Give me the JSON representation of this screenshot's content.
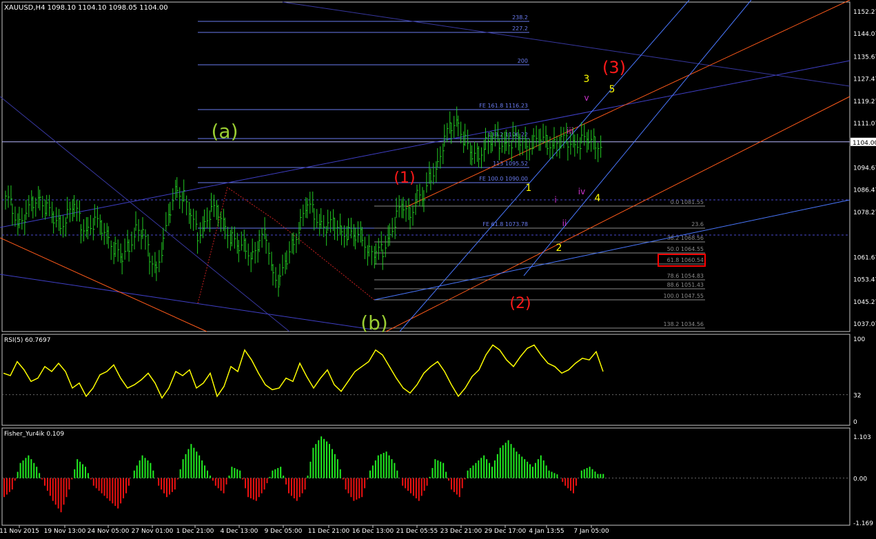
{
  "main": {
    "symbol_header": "XAUUSD,H4 1098.10 1104.10 1098.05 1104.00",
    "price_axis": [
      "1152.27",
      "1144.07",
      "1135.67",
      "1127.47",
      "1119.27",
      "1111.07",
      "1104.00",
      "1094.67",
      "1086.47",
      "1078.27",
      "1061.67",
      "1053.47",
      "1045.27",
      "1037.07"
    ],
    "current_price_label": "1104.00",
    "fib_levels": [
      {
        "label": "238.2",
        "color": "#6a7cf0"
      },
      {
        "label": "227.2",
        "color": "#6a7cf0"
      },
      {
        "label": "200",
        "color": "#6a7cf0"
      },
      {
        "label": "FE 161.8 1116.23",
        "color": "#6a7cf0"
      },
      {
        "label": "138.2 1106.22",
        "color": "#6a7cf0"
      },
      {
        "label": "113 1095.52",
        "color": "#6a7cf0"
      },
      {
        "label": "FE 100.0 1090.00",
        "color": "#6a7cf0"
      },
      {
        "label": "0.0 1081.55",
        "color": "#8a8a8a"
      },
      {
        "label": "FE 61.8 1073.78",
        "color": "#6a7cf0"
      },
      {
        "label": "23.6",
        "color": "#8a8a8a"
      },
      {
        "label": "38.2 1068.56",
        "color": "#8a8a8a"
      },
      {
        "label": "50.0 1064.55",
        "color": "#8a8a8a"
      },
      {
        "label": "61.8 1060.54",
        "color": "#8a8a8a"
      },
      {
        "label": "78.6 1054.83",
        "color": "#8a8a8a"
      },
      {
        "label": "88.6 1051.43",
        "color": "#8a8a8a"
      },
      {
        "label": "100.0 1047.55",
        "color": "#8a8a8a"
      },
      {
        "label": "138.2 1034.56",
        "color": "#8a8a8a"
      }
    ],
    "wave_labels": [
      {
        "text": "(a)",
        "color": "#9acd32"
      },
      {
        "text": "(b)",
        "color": "#9acd32"
      },
      {
        "text": "(1)",
        "color": "#ff1a1a"
      },
      {
        "text": "(2)",
        "color": "#ff1a1a"
      },
      {
        "text": "(3)",
        "color": "#ff1a1a"
      },
      {
        "text": "1",
        "color": "#ffff00"
      },
      {
        "text": "2",
        "color": "#ffff00"
      },
      {
        "text": "3",
        "color": "#ffff00"
      },
      {
        "text": "4",
        "color": "#ffff00"
      },
      {
        "text": "5",
        "color": "#ffff00"
      },
      {
        "text": "i",
        "color": "#cc33cc"
      },
      {
        "text": "ii",
        "color": "#cc33cc"
      },
      {
        "text": "iii",
        "color": "#cc33cc"
      },
      {
        "text": "iv",
        "color": "#cc33cc"
      },
      {
        "text": "v",
        "color": "#cc33cc"
      }
    ]
  },
  "rsi": {
    "header": "RSI(5) 60.7697",
    "axis": [
      "100",
      "32",
      "0"
    ],
    "color": "#ffff00"
  },
  "fisher": {
    "header": "Fisher_Yur4ik 0.109",
    "axis": [
      "1.103",
      "0.00",
      "-1.169"
    ],
    "pos_color": "#22ee22",
    "neg_color": "#ee1111"
  },
  "time_axis": [
    "11 Nov 2015",
    "19 Nov 13:00",
    "24 Nov 05:00",
    "27 Nov 01:00",
    "1 Dec 21:00",
    "4 Dec 13:00",
    "9 Dec 05:00",
    "11 Dec 21:00",
    "16 Dec 13:00",
    "21 Dec 05:55",
    "23 Dec 21:00",
    "29 Dec 17:00",
    "4 Jan 13:55",
    "7 Jan 05:00"
  ],
  "chart_data": {
    "type": "line",
    "title": "XAUUSD,H4",
    "ohlc_last": {
      "open": 1098.1,
      "high": 1104.1,
      "low": 1098.05,
      "close": 1104.0
    },
    "price_series": {
      "x_index": [
        0,
        10,
        20,
        30,
        40,
        50,
        60,
        70,
        80,
        90,
        100,
        110,
        120,
        130,
        140,
        150,
        160,
        170,
        180,
        190,
        200,
        210,
        220,
        230,
        240,
        250,
        260,
        270,
        280,
        290,
        300,
        310,
        320,
        330,
        340,
        350,
        360,
        370,
        380,
        390,
        400,
        410,
        420,
        430,
        440,
        450,
        460,
        470,
        480,
        490,
        500,
        510,
        520,
        530,
        540,
        550,
        560,
        570,
        580,
        590,
        600,
        610,
        620,
        630,
        640,
        650,
        660,
        670,
        680,
        690,
        700,
        710,
        720,
        730,
        740,
        750,
        760,
        770,
        780,
        790,
        800,
        810,
        820,
        830,
        840,
        850,
        860,
        870
      ],
      "close": [
        1084,
        1080,
        1074,
        1076,
        1082,
        1084,
        1079,
        1075,
        1074,
        1077,
        1080,
        1074,
        1072,
        1074,
        1072,
        1070,
        1064,
        1060,
        1066,
        1072,
        1070,
        1062,
        1058,
        1066,
        1078,
        1088,
        1084,
        1076,
        1070,
        1074,
        1078,
        1078,
        1074,
        1068,
        1064,
        1066,
        1062,
        1066,
        1070,
        1056,
        1052,
        1060,
        1068,
        1074,
        1080,
        1078,
        1074,
        1072,
        1074,
        1072,
        1070,
        1068,
        1070,
        1064,
        1062,
        1064,
        1070,
        1076,
        1080,
        1078,
        1084,
        1082,
        1092,
        1096,
        1104,
        1110,
        1112,
        1104,
        1098,
        1100,
        1104,
        1104,
        1104,
        1104,
        1104,
        1104,
        1104,
        1104,
        1104,
        1104,
        1104,
        1104,
        1104,
        1104,
        1104,
        1104,
        1104,
        1104
      ]
    },
    "rsi_series": [
      58,
      55,
      72,
      62,
      48,
      52,
      66,
      60,
      70,
      60,
      40,
      46,
      30,
      40,
      56,
      60,
      68,
      52,
      40,
      44,
      50,
      58,
      46,
      28,
      40,
      60,
      55,
      62,
      40,
      46,
      58,
      30,
      42,
      66,
      60,
      86,
      74,
      58,
      44,
      38,
      40,
      52,
      48,
      70,
      54,
      40,
      52,
      62,
      44,
      36,
      48,
      60,
      66,
      72,
      86,
      80,
      66,
      52,
      40,
      34,
      44,
      58,
      66,
      72,
      60,
      44,
      30,
      40,
      54,
      62,
      80,
      92,
      86,
      74,
      66,
      78,
      88,
      92,
      80,
      70,
      66,
      58,
      62,
      70,
      76,
      74,
      84,
      60
    ],
    "fisher_series": [
      -0.5,
      -0.3,
      0.4,
      0.6,
      0.3,
      -0.2,
      -0.6,
      -0.9,
      -0.3,
      0.5,
      0.3,
      -0.2,
      -0.4,
      -0.6,
      -0.8,
      -0.4,
      0.2,
      0.6,
      0.4,
      -0.2,
      -0.5,
      -0.3,
      0.5,
      0.9,
      0.6,
      0.2,
      -0.2,
      -0.4,
      0.3,
      0.2,
      -0.5,
      -0.6,
      -0.3,
      0.2,
      0.3,
      -0.4,
      -0.6,
      -0.3,
      0.8,
      1.1,
      0.9,
      0.5,
      -0.3,
      -0.6,
      -0.5,
      0.2,
      0.6,
      0.7,
      0.4,
      -0.2,
      -0.4,
      -0.6,
      -0.2,
      0.5,
      0.4,
      -0.3,
      -0.5,
      0.2,
      0.4,
      0.6,
      0.3,
      0.8,
      1.0,
      0.7,
      0.5,
      0.3,
      0.6,
      0.2,
      0.1,
      -0.2,
      -0.4,
      0.2,
      0.3,
      0.11
    ],
    "ylim_price": [
      1037.07,
      1152.27
    ],
    "ylim_rsi": [
      0,
      100
    ],
    "ylim_fisher": [
      -1.169,
      1.103
    ]
  }
}
